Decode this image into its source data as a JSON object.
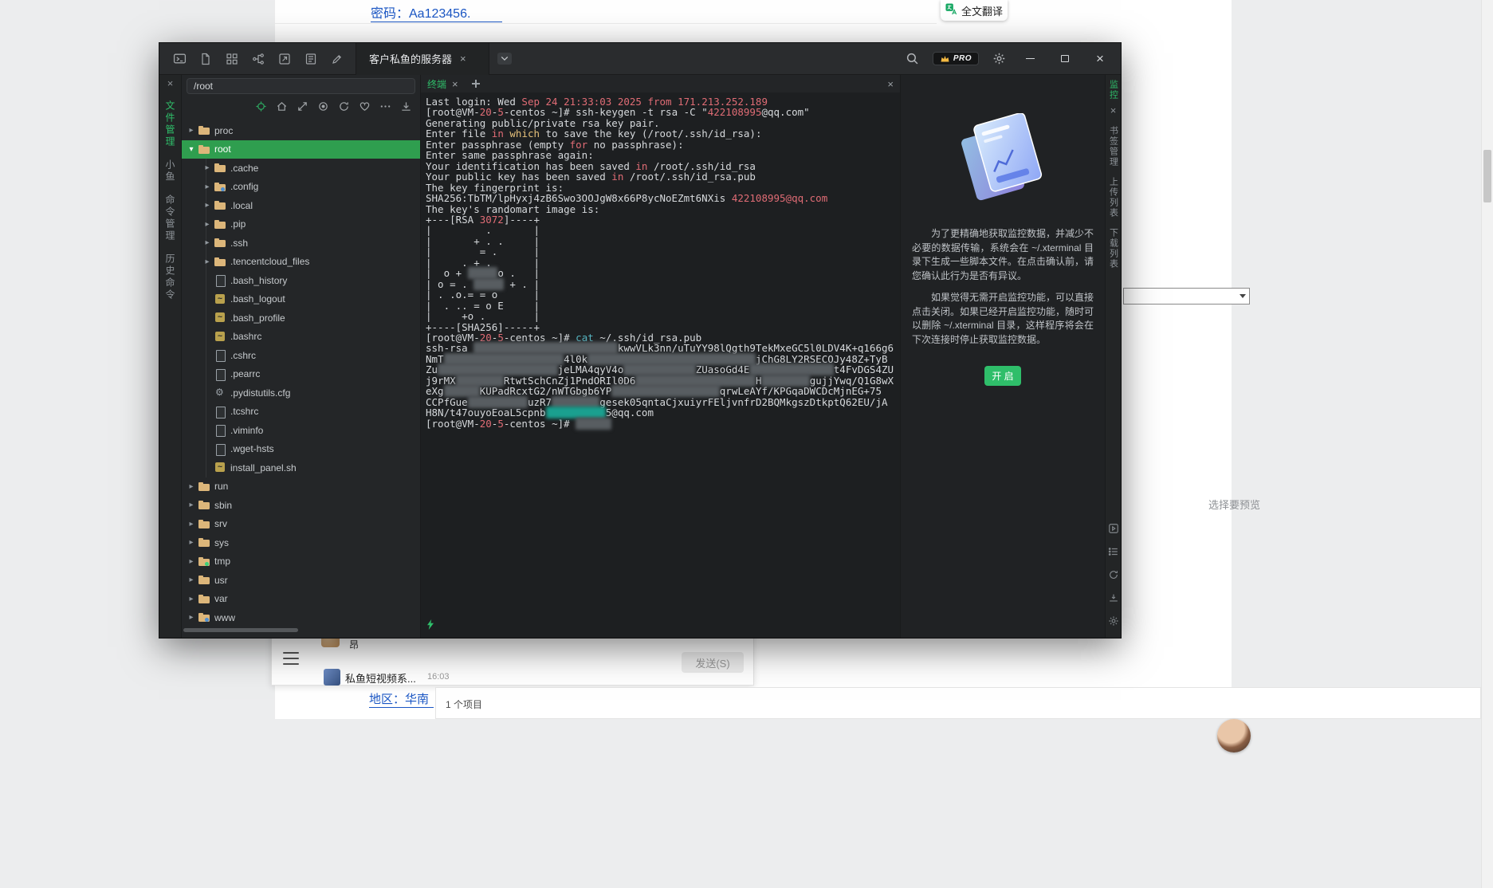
{
  "page": {
    "password_text": "密码：Aa123456.",
    "translate_label": "全文翻译",
    "preview_hint": "选择要预览",
    "region_text": "地区：华南",
    "items_count": "1 个项目",
    "chat": {
      "sticker_label": "昂",
      "conversation_name": "私鱼短视频系...",
      "time": "16:03",
      "send_label": "发送(S)"
    }
  },
  "window": {
    "tab_title": "客户私鱼的服务器",
    "pro_label": "PRO",
    "colors": {
      "accent_green": "#2fbe6a",
      "selection_green": "#2f9e4f",
      "terminal_red": "#e06c75",
      "terminal_yellow": "#e5c07b",
      "terminal_cyan": "#56b6c2"
    },
    "left_rail": [
      {
        "label": "文件管理",
        "active": true
      },
      {
        "label": "小鱼",
        "active": false
      },
      {
        "label": "命令管理",
        "active": false
      },
      {
        "label": "历史命令",
        "active": false
      }
    ],
    "right_rail": [
      {
        "label": "书签管理"
      },
      {
        "label": "上传列表"
      },
      {
        "label": "下载列表"
      }
    ],
    "file_panel": {
      "path": "/root",
      "tree": [
        {
          "name": "proc",
          "icon": "folder",
          "level": 1,
          "arrow": "right"
        },
        {
          "name": "root",
          "icon": "folder",
          "level": 1,
          "arrow": "down",
          "selected": true
        },
        {
          "name": ".cache",
          "icon": "folder",
          "level": 2,
          "arrow": "right"
        },
        {
          "name": ".config",
          "icon": "folder-config",
          "level": 2,
          "arrow": "right"
        },
        {
          "name": ".local",
          "icon": "folder",
          "level": 2,
          "arrow": "right"
        },
        {
          "name": ".pip",
          "icon": "folder",
          "level": 2,
          "arrow": "right"
        },
        {
          "name": ".ssh",
          "icon": "folder",
          "level": 2,
          "arrow": "right"
        },
        {
          "name": ".tencentcloud_files",
          "icon": "folder",
          "level": 2,
          "arrow": "right"
        },
        {
          "name": ".bash_history",
          "icon": "file",
          "level": 2,
          "arrow": "none"
        },
        {
          "name": ".bash_logout",
          "icon": "script",
          "level": 2,
          "arrow": "none"
        },
        {
          "name": ".bash_profile",
          "icon": "script",
          "level": 2,
          "arrow": "none"
        },
        {
          "name": ".bashrc",
          "icon": "script",
          "level": 2,
          "arrow": "none"
        },
        {
          "name": ".cshrc",
          "icon": "file",
          "level": 2,
          "arrow": "none"
        },
        {
          "name": ".pearrc",
          "icon": "file",
          "level": 2,
          "arrow": "none"
        },
        {
          "name": ".pydistutils.cfg",
          "icon": "gear",
          "level": 2,
          "arrow": "none"
        },
        {
          "name": ".tcshrc",
          "icon": "file",
          "level": 2,
          "arrow": "none"
        },
        {
          "name": ".viminfo",
          "icon": "file",
          "level": 2,
          "arrow": "none"
        },
        {
          "name": ".wget-hsts",
          "icon": "file",
          "level": 2,
          "arrow": "none"
        },
        {
          "name": "install_panel.sh",
          "icon": "script",
          "level": 2,
          "arrow": "none"
        },
        {
          "name": "run",
          "icon": "folder",
          "level": 1,
          "arrow": "right"
        },
        {
          "name": "sbin",
          "icon": "folder",
          "level": 1,
          "arrow": "right"
        },
        {
          "name": "srv",
          "icon": "folder",
          "level": 1,
          "arrow": "right"
        },
        {
          "name": "sys",
          "icon": "folder",
          "level": 1,
          "arrow": "right"
        },
        {
          "name": "tmp",
          "icon": "folder-clock",
          "level": 1,
          "arrow": "right"
        },
        {
          "name": "usr",
          "icon": "folder",
          "level": 1,
          "arrow": "right"
        },
        {
          "name": "var",
          "icon": "folder",
          "level": 1,
          "arrow": "right"
        },
        {
          "name": "www",
          "icon": "folder-web",
          "level": 1,
          "arrow": "right"
        }
      ]
    },
    "terminal": {
      "tab_label": "终端",
      "lines": [
        [
          {
            "t": "Last login: Wed ",
            "c": "w"
          },
          {
            "t": "Sep 24 21:33:03 2025 from 171.213.252.189",
            "c": "r"
          }
        ],
        [
          {
            "t": "[root@VM-",
            "c": "w"
          },
          {
            "t": "20",
            "c": "r"
          },
          {
            "t": "-",
            "c": "w"
          },
          {
            "t": "5",
            "c": "r"
          },
          {
            "t": "-centos ~]# ssh-keygen -t rsa -C \"",
            "c": "w"
          },
          {
            "t": "422108995",
            "c": "r"
          },
          {
            "t": "@qq.com\"",
            "c": "w"
          }
        ],
        [
          {
            "t": "Generating public/private rsa key pair.",
            "c": "w"
          }
        ],
        [
          {
            "t": "Enter file ",
            "c": "w"
          },
          {
            "t": "in",
            "c": "r"
          },
          {
            "t": " ",
            "c": "w"
          },
          {
            "t": "which",
            "c": "y"
          },
          {
            "t": " to save the key (/root/.ssh/id_rsa):",
            "c": "w"
          }
        ],
        [
          {
            "t": "Enter passphrase (empty ",
            "c": "w"
          },
          {
            "t": "for",
            "c": "r"
          },
          {
            "t": " no passphrase):",
            "c": "w"
          }
        ],
        [
          {
            "t": "Enter same passphrase again:",
            "c": "w"
          }
        ],
        [
          {
            "t": "Your identification has been saved ",
            "c": "w"
          },
          {
            "t": "in",
            "c": "r"
          },
          {
            "t": " /root/.ssh/id_rsa",
            "c": "w"
          }
        ],
        [
          {
            "t": "Your public key has been saved ",
            "c": "w"
          },
          {
            "t": "in",
            "c": "r"
          },
          {
            "t": " /root/.ssh/id_rsa.pub",
            "c": "w"
          }
        ],
        [
          {
            "t": "The key fingerprint is:",
            "c": "w"
          }
        ],
        [
          {
            "t": "SHA256:TbTM/lpHyxj4zB6Swo3OOJgW8x66P8ycNoEZmt6NXis ",
            "c": "w"
          },
          {
            "t": "422108995@qq.com",
            "c": "r"
          }
        ],
        [
          {
            "t": "The key's randomart image is:",
            "c": "w"
          }
        ],
        [
          {
            "t": "+---[RSA ",
            "c": "w"
          },
          {
            "t": "3072",
            "c": "r"
          },
          {
            "t": "]----+",
            "c": "w"
          }
        ],
        [
          {
            "t": "|         .       |",
            "c": "w"
          }
        ],
        [
          {
            "t": "|       + . .     |",
            "c": "w"
          }
        ],
        [
          {
            "t": "|        = .      |",
            "c": "w"
          }
        ],
        [
          {
            "t": "|     . + .       |",
            "c": "w"
          }
        ],
        [
          {
            "t": "|  o + ",
            "c": "w"
          },
          {
            "t": "#####",
            "c": "blur"
          },
          {
            "t": "o .   |",
            "c": "w"
          }
        ],
        [
          {
            "t": "| o = . ",
            "c": "w"
          },
          {
            "t": "#####",
            "c": "blur"
          },
          {
            "t": " + . |",
            "c": "w"
          }
        ],
        [
          {
            "t": "| . .o.= = o      |",
            "c": "w"
          }
        ],
        [
          {
            "t": "|  . .. = o E     |",
            "c": "w"
          }
        ],
        [
          {
            "t": "|     +o .        |",
            "c": "w"
          }
        ],
        [
          {
            "t": "+----[SHA256]-----+",
            "c": "w"
          }
        ],
        [
          {
            "t": "[root@VM-",
            "c": "w"
          },
          {
            "t": "20",
            "c": "r"
          },
          {
            "t": "-",
            "c": "w"
          },
          {
            "t": "5",
            "c": "r"
          },
          {
            "t": "-centos ~]# ",
            "c": "w"
          },
          {
            "t": "cat",
            "c": "c"
          },
          {
            "t": " ~/.ssh/id_rsa.pub",
            "c": "w"
          }
        ],
        [
          {
            "t": "ssh-rsa ",
            "c": "w"
          },
          {
            "t": "########################",
            "c": "blur"
          },
          {
            "t": "kwwVLk3nn/uTuYY98lQgth9TekMxeGC5l0LDV4K+q166g6",
            "c": "w"
          }
        ],
        [
          {
            "t": "NmT",
            "c": "w"
          },
          {
            "t": "####################",
            "c": "blur"
          },
          {
            "t": "4l0k",
            "c": "w"
          },
          {
            "t": "############################",
            "c": "blur"
          },
          {
            "t": "jChG8LY2RSECOJy48Z+TyB",
            "c": "w"
          }
        ],
        [
          {
            "t": "Zu",
            "c": "w"
          },
          {
            "t": "####################",
            "c": "blur"
          },
          {
            "t": "jeLMA4qyV4o",
            "c": "w"
          },
          {
            "t": "############",
            "c": "blur"
          },
          {
            "t": "ZUasoGd4E",
            "c": "w"
          },
          {
            "t": "##############",
            "c": "blur"
          },
          {
            "t": "t4FvDGS4ZU",
            "c": "w"
          }
        ],
        [
          {
            "t": "j9rMX",
            "c": "w"
          },
          {
            "t": "########",
            "c": "blur"
          },
          {
            "t": "RtwtSchCnZj1PndORIl0D6",
            "c": "w"
          },
          {
            "t": "####################",
            "c": "blur"
          },
          {
            "t": "H",
            "c": "w"
          },
          {
            "t": "########",
            "c": "blur"
          },
          {
            "t": "gujjYwq/Q1G8wX",
            "c": "w"
          }
        ],
        [
          {
            "t": "eXg",
            "c": "w"
          },
          {
            "t": "######",
            "c": "blur"
          },
          {
            "t": "KUPadRcxtG2/nWTGbgb6YP",
            "c": "w"
          },
          {
            "t": "##################",
            "c": "blur"
          },
          {
            "t": "qrwLeAYf/KPGqaDWCDcMjnEG+75",
            "c": "w"
          }
        ],
        [
          {
            "t": "CCPfGue",
            "c": "w"
          },
          {
            "t": "##########",
            "c": "blur"
          },
          {
            "t": "uzR7",
            "c": "w"
          },
          {
            "t": "########",
            "c": "blur"
          },
          {
            "t": "gesek05qntaCjxuiyrFEljvnfrD2BQMkgszDtkptQ62EU/jA",
            "c": "w"
          }
        ],
        [
          {
            "t": "H8N/t47ouyoEoaL5cpnb",
            "c": "w"
          },
          {
            "t": "##########",
            "c": "blurT"
          },
          {
            "t": "5@qq.com",
            "c": "w"
          }
        ],
        [
          {
            "t": "[root@VM-",
            "c": "w"
          },
          {
            "t": "20",
            "c": "r"
          },
          {
            "t": "-",
            "c": "w"
          },
          {
            "t": "5",
            "c": "r"
          },
          {
            "t": "-centos ~]# ",
            "c": "w"
          },
          {
            "t": "######",
            "c": "blur"
          }
        ]
      ]
    },
    "monitor": {
      "tab_label": "监控",
      "paragraph1": "为了更精确地获取监控数据，并减少不必要的数据传输，系统会在 ~/.xterminal 目录下生成一些脚本文件。在点击确认前，请您确认此行为是否有异议。",
      "paragraph2": "如果觉得无需开启监控功能，可以直接点击关闭。如果已经开启监控功能，随时可以删除 ~/.xterminal 目录，这样程序将会在下次连接时停止获取监控数据。",
      "enable_label": "开 启"
    }
  }
}
